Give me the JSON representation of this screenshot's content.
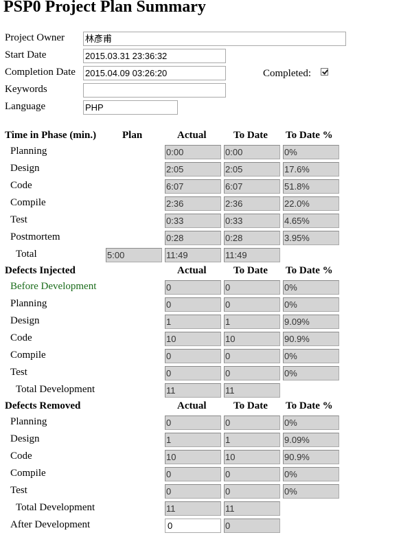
{
  "title": "PSP0 Project Plan Summary",
  "info": {
    "owner_label": "Project Owner",
    "owner_value": "林彥甫",
    "start_label": "Start Date",
    "start_value": "2015.03.31 23:36:32",
    "completion_label": "Completion Date",
    "completion_value": "2015.04.09 03:26:20",
    "completed_label": "Completed:",
    "completed_checked": true,
    "keywords_label": "Keywords",
    "keywords_value": "",
    "language_label": "Language",
    "language_value": "PHP"
  },
  "time": {
    "header": "Time in Phase (min.)",
    "col_plan": "Plan",
    "col_actual": "Actual",
    "col_todate": "To Date",
    "col_todate_pct": "To Date %",
    "rows": [
      {
        "name": "Planning",
        "actual": "0:00",
        "todate": "0:00",
        "pct": "0%"
      },
      {
        "name": "Design",
        "actual": "2:05",
        "todate": "2:05",
        "pct": "17.6%"
      },
      {
        "name": "Code",
        "actual": "6:07",
        "todate": "6:07",
        "pct": "51.8%"
      },
      {
        "name": "Compile",
        "actual": "2:36",
        "todate": "2:36",
        "pct": "22.0%"
      },
      {
        "name": "Test",
        "actual": "0:33",
        "todate": "0:33",
        "pct": "4.65%"
      },
      {
        "name": "Postmortem",
        "actual": "0:28",
        "todate": "0:28",
        "pct": "3.95%"
      }
    ],
    "total": {
      "name": "Total",
      "plan": "5:00",
      "actual": "11:49",
      "todate": "11:49"
    }
  },
  "injected": {
    "header": "Defects Injected",
    "col_actual": "Actual",
    "col_todate": "To Date",
    "col_todate_pct": "To Date %",
    "rows": [
      {
        "name": "Before Development",
        "actual": "0",
        "todate": "0",
        "pct": "0%"
      },
      {
        "name": "Planning",
        "actual": "0",
        "todate": "0",
        "pct": "0%"
      },
      {
        "name": "Design",
        "actual": "1",
        "todate": "1",
        "pct": "9.09%"
      },
      {
        "name": "Code",
        "actual": "10",
        "todate": "10",
        "pct": "90.9%"
      },
      {
        "name": "Compile",
        "actual": "0",
        "todate": "0",
        "pct": "0%"
      },
      {
        "name": "Test",
        "actual": "0",
        "todate": "0",
        "pct": "0%"
      }
    ],
    "total": {
      "name": "Total Development",
      "actual": "11",
      "todate": "11"
    }
  },
  "removed": {
    "header": "Defects Removed",
    "col_actual": "Actual",
    "col_todate": "To Date",
    "col_todate_pct": "To Date %",
    "rows": [
      {
        "name": "Planning",
        "actual": "0",
        "todate": "0",
        "pct": "0%"
      },
      {
        "name": "Design",
        "actual": "1",
        "todate": "1",
        "pct": "9.09%"
      },
      {
        "name": "Code",
        "actual": "10",
        "todate": "10",
        "pct": "90.9%"
      },
      {
        "name": "Compile",
        "actual": "0",
        "todate": "0",
        "pct": "0%"
      },
      {
        "name": "Test",
        "actual": "0",
        "todate": "0",
        "pct": "0%"
      }
    ],
    "total": {
      "name": "Total Development",
      "actual": "11",
      "todate": "11"
    },
    "after": {
      "name": "After Development",
      "actual": "0",
      "todate": "0"
    }
  }
}
